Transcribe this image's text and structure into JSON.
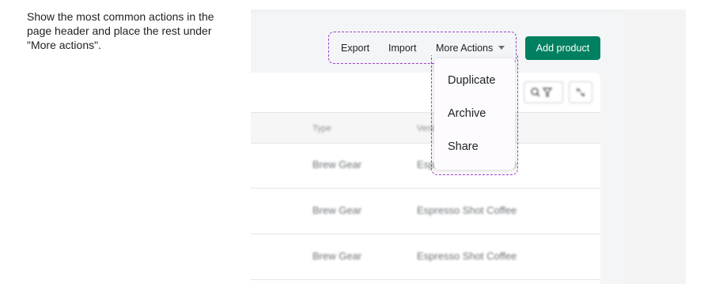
{
  "caption": "Show the most common actions in the page header and place the rest under \"More actions\".",
  "header_actions": {
    "export_label": "Export",
    "import_label": "Import",
    "more_actions_label": "More Actions",
    "add_product_label": "Add product"
  },
  "more_actions_menu": {
    "items": [
      "Duplicate",
      "Archive",
      "Share"
    ]
  },
  "table": {
    "columns": [
      "Type",
      "Vendor"
    ],
    "rows": [
      {
        "type": "Brew Gear",
        "vendor": "Espresso Shot Coffee"
      },
      {
        "type": "Brew Gear",
        "vendor": "Espresso Shot Coffee"
      },
      {
        "type": "Brew Gear",
        "vendor": "Espresso Shot Coffee"
      }
    ]
  },
  "colors": {
    "primary": "#008060",
    "highlight_outline": "#9a40c9"
  }
}
